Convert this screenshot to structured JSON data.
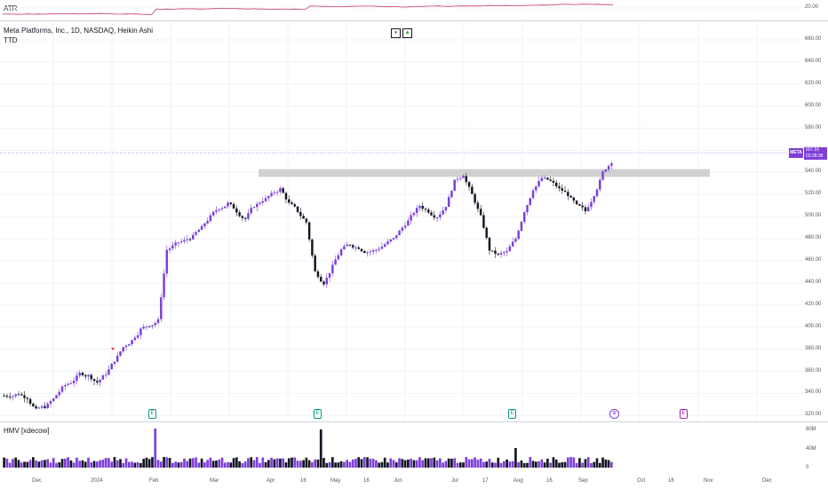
{
  "atr": {
    "label": "ATR",
    "value_label": "20.00"
  },
  "main": {
    "title": "Meta Platforms, Inc., 1D, NASDAQ, Heikin Ashi",
    "subtitle": "TTD",
    "buttons": [
      "▾",
      "◆"
    ],
    "price_badge": "META",
    "price_value": "557.91",
    "price_time": "03:28:38",
    "resistance_zone": [
      536,
      543
    ],
    "earnings_markers": [
      "E",
      "E",
      "E",
      "⊕",
      "E"
    ],
    "y_ticks": [
      "660.00",
      "640.00",
      "620.00",
      "600.00",
      "580.00",
      "560.00",
      "540.00",
      "520.00",
      "500.00",
      "480.00",
      "460.00",
      "440.00",
      "420.00",
      "400.00",
      "380.00",
      "360.00",
      "340.00",
      "320.00"
    ]
  },
  "volume": {
    "label": "HMV [xdecow]",
    "y_ticks": [
      "80M",
      "40M",
      "0"
    ]
  },
  "time_axis": {
    "labels": [
      "Dec",
      "2024",
      "Feb",
      "Mar",
      "Apr",
      "16",
      "May",
      "16",
      "Jun",
      "Jul",
      "17",
      "Aug",
      "16",
      "Sep",
      "Oct",
      "16",
      "Nov",
      "Dec"
    ]
  },
  "colors": {
    "bull": "#7e3fd8",
    "bear": "#131722",
    "atr_line": "#c7385b",
    "zone": "#bdbdbd"
  },
  "chart_data": {
    "type": "candlestick",
    "title": "Meta Platforms, Inc., 1D, NASDAQ, Heikin Ashi",
    "ylim": [
      315,
      668
    ],
    "series_close_approx": [
      338,
      340,
      336,
      325,
      328,
      335,
      345,
      350,
      358,
      356,
      350,
      358,
      370,
      382,
      388,
      398,
      402,
      406,
      470,
      475,
      478,
      482,
      490,
      500,
      508,
      512,
      505,
      498,
      510,
      515,
      520,
      525,
      512,
      505,
      495,
      450,
      440,
      455,
      470,
      475,
      472,
      468,
      470,
      475,
      480,
      490,
      500,
      510,
      505,
      500,
      510,
      532,
      538,
      520,
      500,
      470,
      465,
      468,
      480,
      505,
      525,
      535,
      532,
      525,
      520,
      510,
      505,
      520,
      540,
      550
    ]
  }
}
